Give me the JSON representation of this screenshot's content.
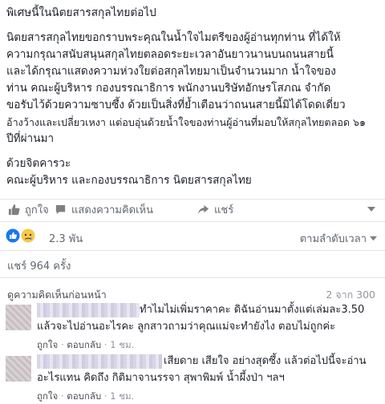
{
  "post": {
    "lines": [
      "พิเศษนี้ในนิตยสารสกุลไทยต่อไป",
      "นิตยสารสกุลไทยขอกราบพระคุณในน้ำใจไมตรีของผู้อ่านทุกท่าน ที่ได้ให้",
      "ความกรุณาสนับสนุนสกุลไทยตลอดระยะเวลาอันยาวนานบนถนนสายนี้",
      "และได้กรุณาแสดงความห่วงใยต่อสกุลไทยมาเป็นจำนวนมาก น้ำใจของ",
      "ท่าน คณะผู้บริหาร กองบรรณาธิการ พนักงานบริษัทอักษรโสภณ จำกัด",
      "ขอรับไว้ด้วยความซาบซึ้ง ด้วยเป็นสิ่งที่ย้ำเตือนว่าถนนสายนี้มิได้โดดเดี่ยว",
      "อ้างว้างและเปลี่ยวเหงา แต่อบอุ่นด้วยน้ำใจของท่านผู้อ่านที่มอบให้สกุลไทยตลอด ๖๑",
      "ปีที่ผ่านมา",
      "ด้วยจิตคารวะ",
      "คณะผู้บริหาร และกองบรรณาธิการ นิตยสารสกุลไทย"
    ]
  },
  "actions": {
    "like": "ถูกใจ",
    "comment": "แสดงความคิดเห็น",
    "share": "แชร์"
  },
  "reactions": {
    "count": "2.3 พัน",
    "order": "ตามลำดับเวลา"
  },
  "shares": "แชร์ 964 ครั้ง",
  "comments_header": {
    "previous": "ดูความคิดเห็นก่อนหน้า",
    "count": "2 จาก 300"
  },
  "comments": [
    {
      "line1": "ทำไมไม่เพิ่มราคาคะ ดิฉันอ่านมาตั้งแต่เล่มละ3.50",
      "line2": "แล้วจะไปอ่านอะไรคะ ลูกสาวถามว่าคุณแม่จะทำยังไง ตอบไม่ถูกค่ะ",
      "like": "ถูกใจ",
      "reply": "ตอบกลับ",
      "time": "1 ชม."
    },
    {
      "line1": "เสียดาย เสียใจ อย่างสุดซึ้ง แล้วต่อไปนี้จะอ่าน",
      "line2": "อะไรแทน คิดถึง กิติมาจานรรจา สุพาพิมพ์ น้ำผึ้งป่า ฯลฯ",
      "like": "ถูกใจ",
      "reply": "ตอบกลับ",
      "time": "1 ชม."
    }
  ],
  "colors": {
    "link_blue": "#4267b2",
    "muted": "#606770",
    "like_blue": "#1877f2",
    "sad_yellow": "#f7c94b"
  }
}
